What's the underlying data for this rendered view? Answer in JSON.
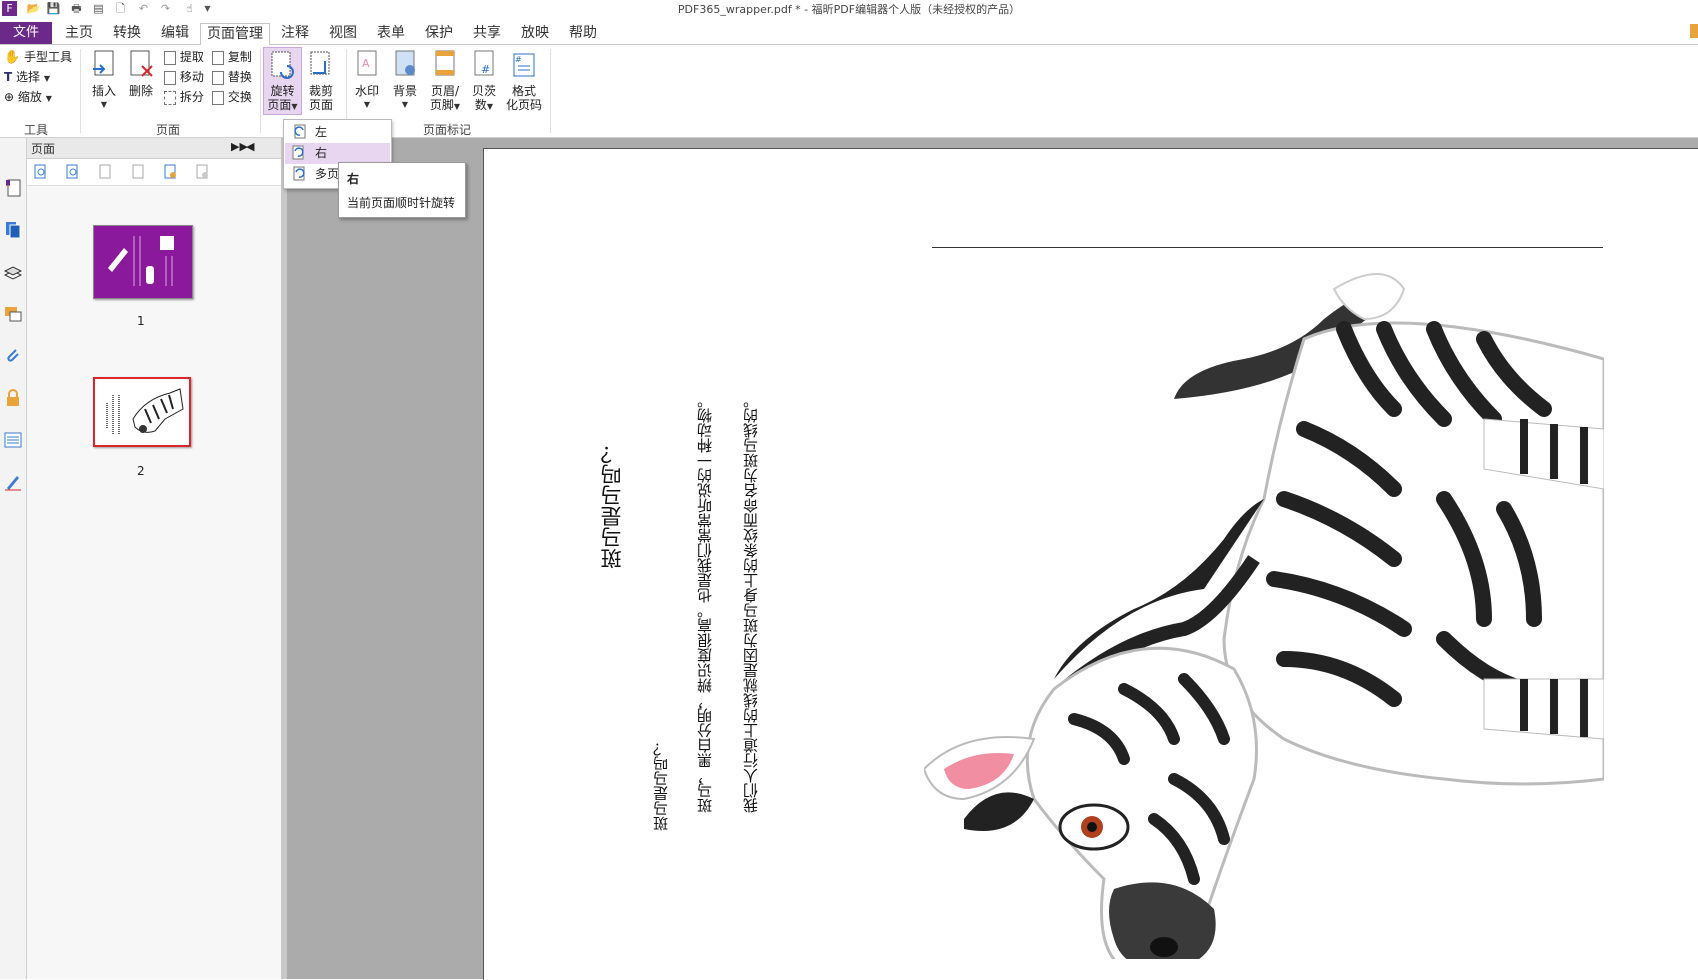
{
  "window": {
    "title": "PDF365_wrapper.pdf * - 福昕PDF编辑器个人版（未经授权的产品）"
  },
  "menu": {
    "tabs": [
      "文件",
      "主页",
      "转换",
      "编辑",
      "页面管理",
      "注释",
      "视图",
      "表单",
      "保护",
      "共享",
      "放映",
      "帮助"
    ],
    "active": "页面管理"
  },
  "ribbon": {
    "tools_group": {
      "label": "工具",
      "hand": "手型工具",
      "select": "选择",
      "zoom": "缩放"
    },
    "pages_group": {
      "label": "页面",
      "insert": "插入",
      "delete": "删除",
      "extract": "提取",
      "move": "移动",
      "split": "拆分",
      "copy": "复制",
      "replace": "替换",
      "swap": "交换"
    },
    "rotate": {
      "line1": "旋转",
      "line2": "页面"
    },
    "crop": {
      "line1": "裁剪",
      "line2": "页面"
    },
    "marks_group": {
      "label": "页面标记",
      "watermark": "水印",
      "background": "背景",
      "header_footer_1": "页眉/",
      "header_footer_2": "页脚",
      "bates_1": "贝茨",
      "bates_2": "数",
      "format_1": "格式",
      "format_2": "化页码"
    }
  },
  "rotate_menu": {
    "items": [
      "左",
      "右",
      "多页"
    ],
    "highlighted": "右"
  },
  "tooltip": {
    "title": "右",
    "description": "当前页面顺时针旋转"
  },
  "pages_panel": {
    "title": "页面",
    "thumbnails": [
      {
        "number": "1",
        "selected": false
      },
      {
        "number": "2",
        "selected": true
      }
    ]
  },
  "document": {
    "heading": "斑马是马吗？",
    "lines": [
      "斑马是马吗？",
      "斑马，黑白分明，辨识度很高。也是我们常常听说的一种动物。",
      "我们人行道上的线就是因为斑马身上的条纹而命名为斑马线的。"
    ]
  },
  "colors": {
    "file_tab": "#6b2a8a",
    "selection": "#e8d6f0",
    "thumb_selected_border": "#d9262a",
    "viewer_bg": "#ababab"
  }
}
